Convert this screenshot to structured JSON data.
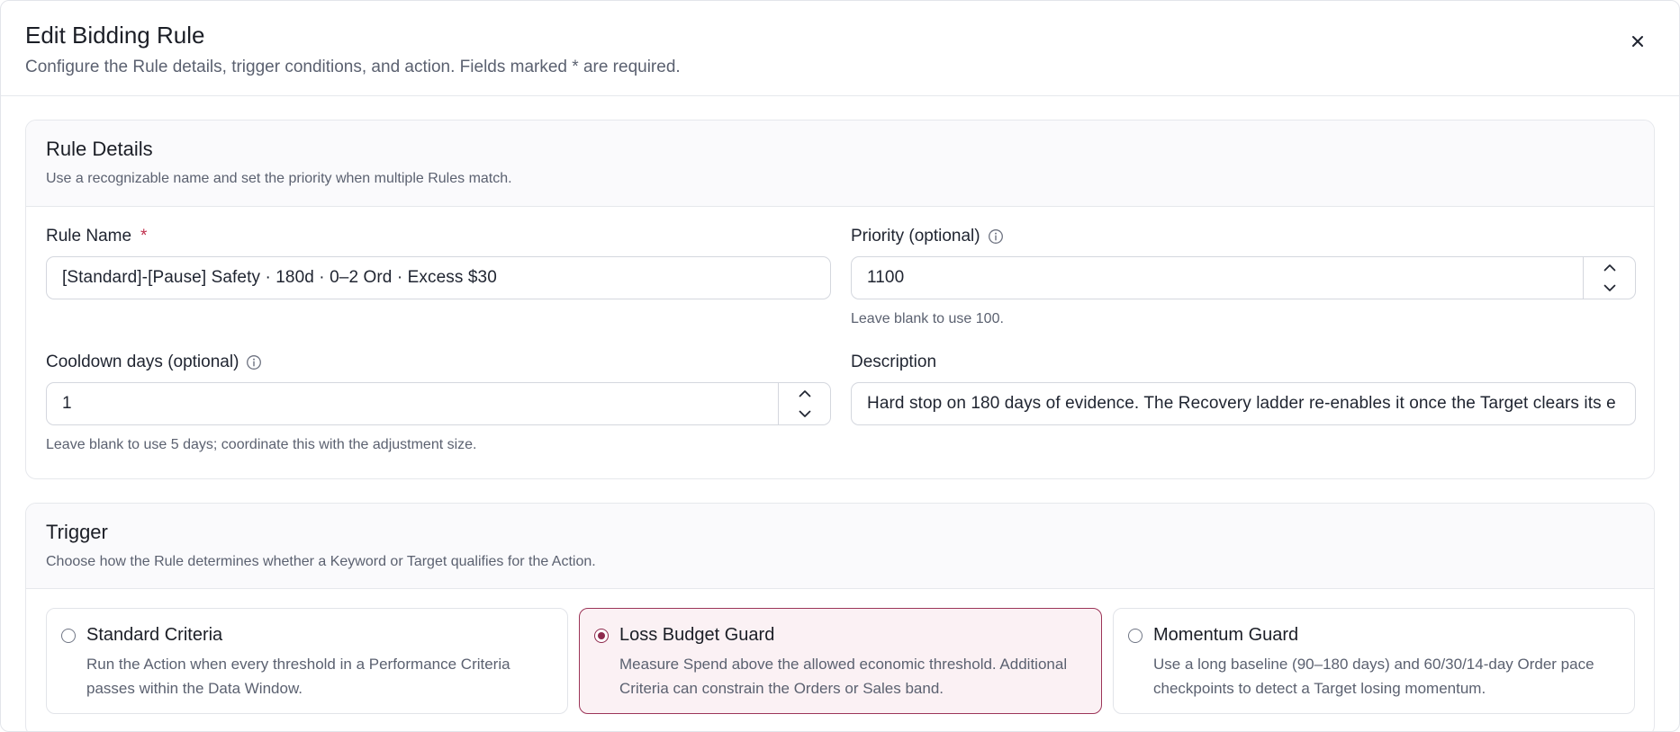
{
  "modal": {
    "title": "Edit Bidding Rule",
    "subtitle": "Configure the Rule details, trigger conditions, and action. Fields marked * are required."
  },
  "rule_details": {
    "title": "Rule Details",
    "description": "Use a recognizable name and set the priority when multiple Rules match.",
    "rule_name": {
      "label": "Rule Name",
      "required_mark": "*",
      "value": "[Standard]-[Pause] Safety · 180d · 0–2 Ord · Excess $30"
    },
    "priority": {
      "label": "Priority (optional)",
      "value": "1100",
      "help": "Leave blank to use 100."
    },
    "cooldown": {
      "label": "Cooldown days (optional)",
      "value": "1",
      "help": "Leave blank to use 5 days; coordinate this with the adjustment size."
    },
    "description_field": {
      "label": "Description",
      "value": "Hard stop on 180 days of evidence. The Recovery ladder re-enables it once the Target clears its e"
    }
  },
  "trigger": {
    "title": "Trigger",
    "description": "Choose how the Rule determines whether a Keyword or Target qualifies for the Action.",
    "options": [
      {
        "title": "Standard Criteria",
        "description": "Run the Action when every threshold in a Performance Criteria passes within the Data Window.",
        "selected": false
      },
      {
        "title": "Loss Budget Guard",
        "description": "Measure Spend above the allowed economic threshold. Additional Criteria can constrain the Orders or Sales band.",
        "selected": true
      },
      {
        "title": "Momentum Guard",
        "description": "Use a long baseline (90–180 days) and 60/30/14-day Order pace checkpoints to detect a Target losing momentum.",
        "selected": false
      }
    ]
  },
  "icons": {
    "close": "close-icon",
    "info": "info-icon",
    "stepper_up": "chevron-up-icon",
    "stepper_down": "chevron-down-icon"
  },
  "colors": {
    "accent": "#8e2a4d",
    "selected_bg": "#fbf1f4",
    "required": "#c0314e"
  }
}
